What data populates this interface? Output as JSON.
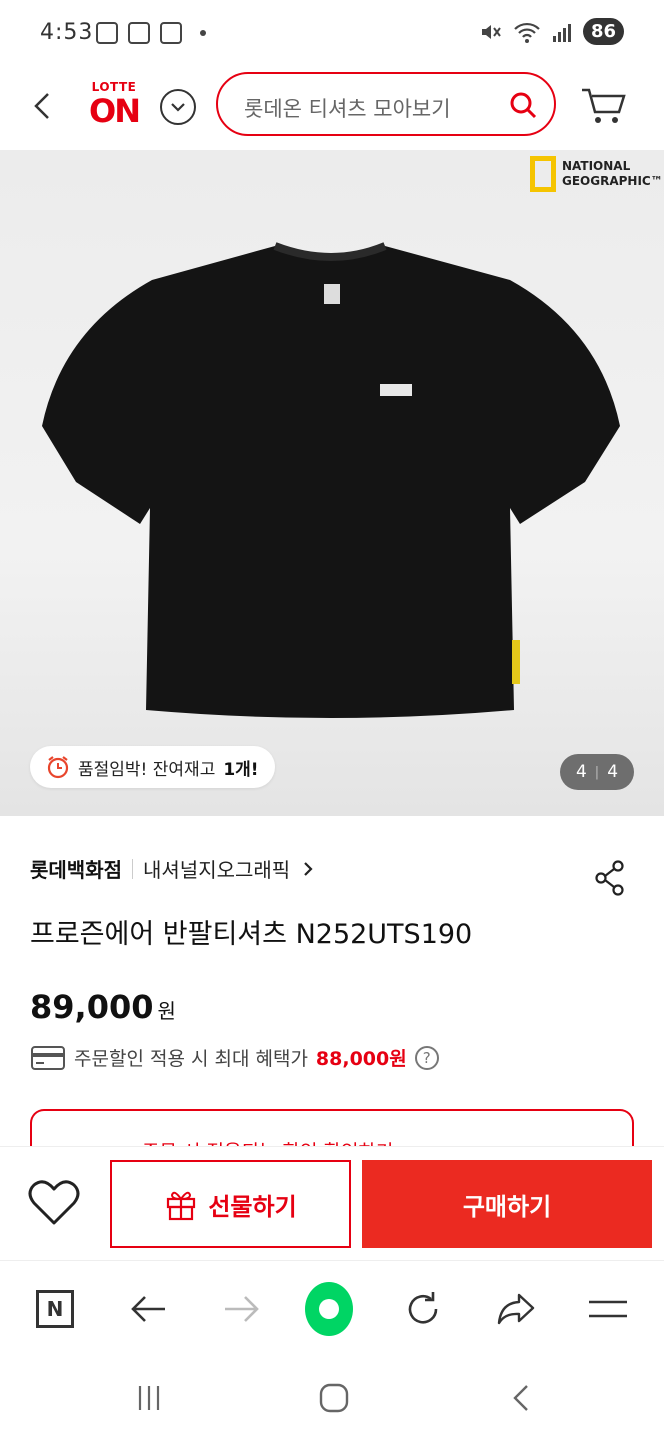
{
  "status_bar": {
    "time": "4:53",
    "battery": "86"
  },
  "header": {
    "logo_top": "LOTTE",
    "logo_main": "ON",
    "search_placeholder": "롯데온 티셔츠 모아보기"
  },
  "product_image": {
    "brand_logo_line1": "NATIONAL",
    "brand_logo_line2": "GEOGRAPHIC™",
    "stock_text": "품절임박! 잔여재고",
    "stock_count": "1개!",
    "page_current": "4",
    "page_total": "4"
  },
  "product": {
    "store": "롯데백화점",
    "brand": "내셔널지오그래픽",
    "title": "프로즌에어 반팔티셔츠 N252UTS190",
    "price": "89,000",
    "price_unit": "원",
    "benefit_text": "주문할인 적용 시 최대 혜택가",
    "benefit_price": "88,000원",
    "coupon_text": "주문 시 적용되는 할인 확인하기 >"
  },
  "actions": {
    "gift_label": "선물하기",
    "buy_label": "구매하기"
  },
  "browser_bar": {
    "n_label": "N"
  },
  "colors": {
    "brand_red": "#e60012",
    "buy_red": "#eb2a21",
    "browser_green": "#00d564"
  }
}
